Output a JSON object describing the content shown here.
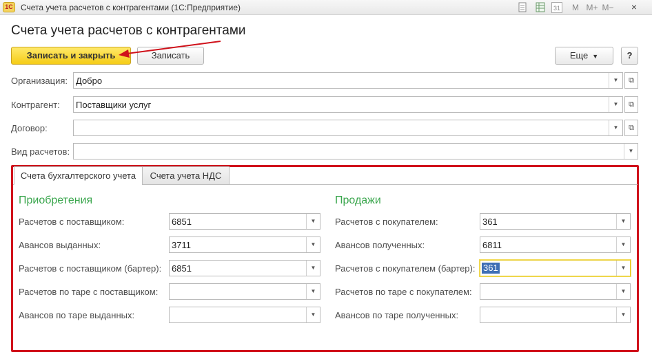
{
  "window": {
    "logo": "1С",
    "title": "Счета учета расчетов с контрагентами  (1С:Предприятие)",
    "toolbar_icons": [
      "document-icon",
      "spreadsheet-icon",
      "calendar-icon",
      "memory-icon",
      "memory-plus-icon",
      "memory-minus-icon"
    ],
    "toolbar_labels": {
      "calendar": "31",
      "m": "M",
      "m_plus": "M+",
      "m_minus": "M−"
    },
    "close": "×"
  },
  "form": {
    "title": "Счета учета расчетов с контрагентами"
  },
  "toolbar": {
    "save_close_label": "Записать и закрыть",
    "save_label": "Записать",
    "more_label": "Еще",
    "help_label": "?"
  },
  "fields": {
    "organization": {
      "label": "Организация:",
      "value": "Добро"
    },
    "counterparty": {
      "label": "Контрагент:",
      "value": "Поставщики услуг"
    },
    "contract": {
      "label": "Договор:",
      "value": ""
    },
    "settlement_type": {
      "label": "Вид расчетов:",
      "value": ""
    }
  },
  "tabs": [
    {
      "label": "Счета бухгалтерского учета",
      "active": true
    },
    {
      "label": "Счета учета НДС",
      "active": false
    }
  ],
  "purchases": {
    "title": "Приобретения",
    "rows": [
      {
        "label": "Расчетов с поставщиком:",
        "value": "6851"
      },
      {
        "label": "Авансов выданных:",
        "value": "3711"
      },
      {
        "label": "Расчетов с поставщиком (бартер):",
        "value": "6851"
      },
      {
        "label": "Расчетов по таре с поставщиком:",
        "value": ""
      },
      {
        "label": "Авансов по таре выданных:",
        "value": ""
      }
    ]
  },
  "sales": {
    "title": "Продажи",
    "rows": [
      {
        "label": "Расчетов с покупателем:",
        "value": "361"
      },
      {
        "label": "Авансов полученных:",
        "value": "6811"
      },
      {
        "label": "Расчетов с покупателем (бартер):",
        "value": "361"
      },
      {
        "label": "Расчетов по таре с покупателем:",
        "value": ""
      },
      {
        "label": "Авансов по таре полученных:",
        "value": ""
      }
    ]
  },
  "colors": {
    "primary_button": "#f5cc16",
    "highlight_frame": "#d0121b",
    "section_title": "#3aa64d",
    "selection": "#3f6fb5"
  }
}
